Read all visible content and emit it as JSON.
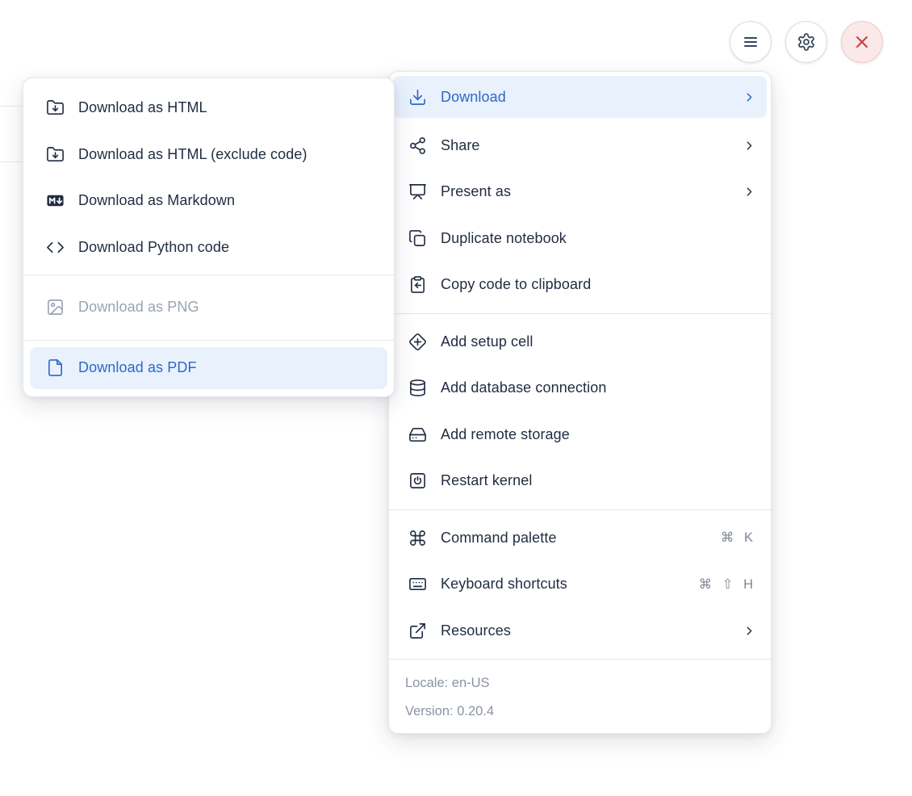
{
  "toolbar": {
    "menu_button": "notebook actions menu",
    "settings_button": "settings",
    "close_button": "shutdown"
  },
  "submenu": {
    "items": [
      {
        "label": "Download as HTML",
        "icon": "folder-down-icon",
        "state": "normal"
      },
      {
        "label": "Download as HTML (exclude code)",
        "icon": "folder-down-icon",
        "state": "normal"
      },
      {
        "label": "Download as Markdown",
        "icon": "markdown-download-icon",
        "state": "normal"
      },
      {
        "label": "Download Python code",
        "icon": "code-icon",
        "state": "normal"
      },
      {
        "label": "Download as PNG",
        "icon": "image-icon",
        "state": "disabled"
      },
      {
        "label": "Download as PDF",
        "icon": "file-icon",
        "state": "highlighted"
      }
    ]
  },
  "main_menu": {
    "items": [
      {
        "label": "Download",
        "icon": "download-icon",
        "has_submenu": true,
        "state": "highlighted"
      },
      {
        "label": "Share",
        "icon": "share-icon",
        "has_submenu": true
      },
      {
        "label": "Present as",
        "icon": "presentation-icon",
        "has_submenu": true
      },
      {
        "label": "Duplicate notebook",
        "icon": "copy-icon"
      },
      {
        "label": "Copy code to clipboard",
        "icon": "clipboard-copy-icon"
      },
      {
        "label": "Add setup cell",
        "icon": "diamond-plus-icon"
      },
      {
        "label": "Add database connection",
        "icon": "database-icon"
      },
      {
        "label": "Add remote storage",
        "icon": "hard-drive-icon"
      },
      {
        "label": "Restart kernel",
        "icon": "power-icon"
      },
      {
        "label": "Command palette",
        "icon": "command-icon",
        "shortcut": "⌘ K"
      },
      {
        "label": "Keyboard shortcuts",
        "icon": "keyboard-icon",
        "shortcut": "⌘ ⇧ H"
      },
      {
        "label": "Resources",
        "icon": "external-link-icon",
        "has_submenu": true
      }
    ],
    "footer": {
      "locale": "Locale: en-US",
      "version": "Version: 0.20.4"
    }
  },
  "colors": {
    "accent_blue": "#2E68C8",
    "highlight_bg": "#E9F1FC",
    "text_dark": "#222D42",
    "text_disabled": "#9AA3B2",
    "text_muted": "#8A93A4",
    "danger_red": "#CC3B3B",
    "danger_bg": "#FBE8E8",
    "separator": "#E4E7EB"
  }
}
